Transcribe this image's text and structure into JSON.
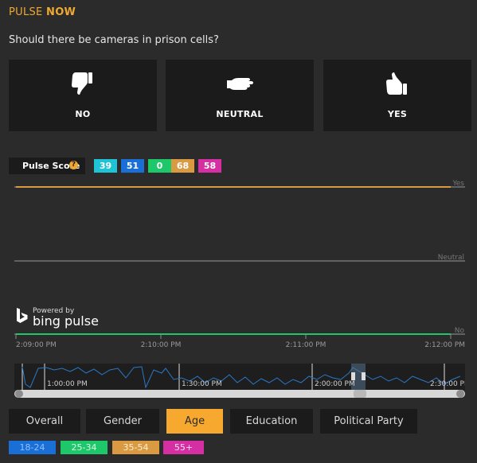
{
  "app": {
    "title_part1": "PULSE",
    "title_part2": "NOW"
  },
  "question": "Should there be cameras in prison cells?",
  "votes": [
    {
      "label": "NO",
      "icon": "thumbs-down-icon"
    },
    {
      "label": "NEUTRAL",
      "icon": "hand-flat-icon"
    },
    {
      "label": "YES",
      "icon": "thumbs-up-icon"
    }
  ],
  "pulse_score": {
    "label": "Pulse Score",
    "help": "?",
    "scores": [
      {
        "value": "39",
        "color": "#1fc3d6"
      },
      {
        "value": "51",
        "color": "#1a6fd6"
      },
      {
        "value": "0",
        "color": "#1ec76a"
      },
      {
        "value": "68",
        "color": "#d99a42"
      },
      {
        "value": "58",
        "color": "#d62ea3"
      }
    ]
  },
  "branding": {
    "powered_by": "Powered by",
    "name": "bing pulse"
  },
  "chart_data": {
    "type": "line",
    "y_levels": [
      "No",
      "Neutral",
      "Yes"
    ],
    "ylim": [
      0,
      100
    ],
    "x_ticks": [
      "2:09:00 PM",
      "2:10:00 PM",
      "2:11:00 PM",
      "2:12:00 PM"
    ],
    "x": [
      0,
      5,
      10,
      15,
      20,
      25,
      30,
      35,
      40,
      45,
      50,
      55,
      60,
      65,
      70,
      75,
      80,
      85,
      90,
      95,
      100,
      105,
      110,
      115,
      120,
      125,
      130,
      135,
      140,
      145,
      150,
      155,
      160,
      165,
      170,
      175,
      180
    ],
    "series": [
      {
        "name": "18-24",
        "color": "#1fc3d6",
        "values": [
          100,
          100,
          100,
          100,
          100,
          100,
          100,
          100,
          100,
          100,
          100,
          100,
          100,
          100,
          100,
          100,
          100,
          100,
          100,
          100,
          100,
          100,
          100,
          100,
          100,
          100,
          100,
          100,
          100,
          100,
          100,
          100,
          100,
          100,
          100,
          100,
          100
        ]
      },
      {
        "name": "25-34",
        "color": "#1a6fd6",
        "values": [
          100,
          100,
          100,
          100,
          100,
          100,
          100,
          100,
          100,
          100,
          100,
          100,
          100,
          100,
          100,
          100,
          100,
          100,
          100,
          100,
          100,
          100,
          100,
          100,
          100,
          100,
          100,
          100,
          100,
          100,
          100,
          100,
          100,
          100,
          100,
          100,
          100
        ]
      },
      {
        "name": "35-54",
        "color": "#d99a42",
        "values": [
          100,
          100,
          100,
          100,
          100,
          100,
          100,
          100,
          100,
          100,
          100,
          100,
          100,
          100,
          100,
          100,
          100,
          100,
          100,
          100,
          100,
          100,
          100,
          100,
          100,
          100,
          100,
          100,
          100,
          100,
          100,
          100,
          100,
          100,
          100,
          100,
          100
        ]
      },
      {
        "name": "55+",
        "color": "#d62ea3",
        "values": [
          0,
          0,
          0,
          0,
          0,
          0,
          0,
          0,
          0,
          0,
          0,
          0,
          0,
          0,
          0,
          0,
          0,
          0,
          0,
          0,
          0,
          0,
          0,
          0,
          0,
          0,
          0,
          0,
          0,
          0,
          0,
          0,
          0,
          0,
          0,
          0,
          0
        ]
      },
      {
        "name": "25-34-green",
        "color": "#1ec76a",
        "values": [
          0,
          0,
          0,
          0,
          0,
          0,
          0,
          0,
          0,
          0,
          0,
          0,
          0,
          0,
          0,
          0,
          0,
          0,
          0,
          0,
          0,
          0,
          0,
          0,
          0,
          0,
          0,
          0,
          0,
          0,
          0,
          0,
          0,
          0,
          0,
          0,
          0
        ]
      }
    ]
  },
  "overview": {
    "ticks": [
      "1:00:00 PM",
      "1:30:00 PM",
      "2:00:00 PM",
      "2:30:00 PM"
    ]
  },
  "tabs": [
    {
      "label": "Overall",
      "active": false
    },
    {
      "label": "Gender",
      "active": false
    },
    {
      "label": "Age",
      "active": true
    },
    {
      "label": "Education",
      "active": false
    },
    {
      "label": "Political Party",
      "active": false
    }
  ],
  "legend": [
    {
      "label": "18-24",
      "color": "#1a6fd6",
      "text_color": "#8fc0ff"
    },
    {
      "label": "25-34",
      "color": "#1ec76a",
      "text_color": "#d6ffe4"
    },
    {
      "label": "35-54",
      "color": "#d99a42",
      "text_color": "#fff0d6"
    },
    {
      "label": "55+",
      "color": "#d62ea3",
      "text_color": "#ffe0f4"
    }
  ]
}
